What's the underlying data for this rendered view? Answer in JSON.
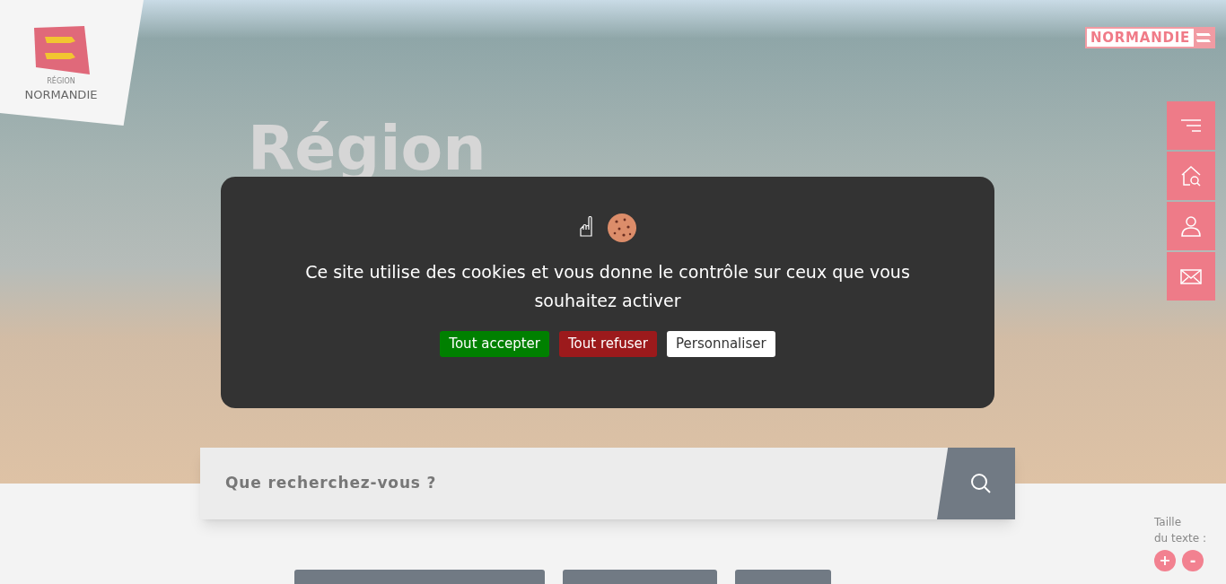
{
  "logo": {
    "small": "RÉGION",
    "large": "NORMANDIE"
  },
  "brand_badge": "NORMANDIE",
  "hero": {
    "title": "Région"
  },
  "side_menu": [
    {
      "kind": "menu"
    },
    {
      "kind": "home-search"
    },
    {
      "kind": "account"
    },
    {
      "kind": "mail"
    }
  ],
  "cookie_banner": {
    "message": "Ce site utilise des cookies et vous donne le contrôle sur ceux que vous souhaitez activer",
    "buttons": [
      {
        "label": "Tout accepter",
        "kind": "accept"
      },
      {
        "label": "Tout refuser",
        "kind": "refuse"
      },
      {
        "label": "Personnaliser",
        "kind": "customize"
      }
    ]
  },
  "search": {
    "placeholder": "Que recherchez-vous ?"
  },
  "text_size": {
    "label_1": "Taille",
    "label_2": "du texte :",
    "increase": "+",
    "decrease": "-"
  }
}
